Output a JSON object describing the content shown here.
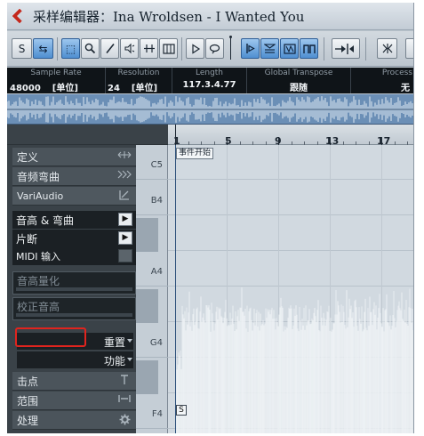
{
  "window": {
    "title": "采样编辑器：Ina Wroldsen - I Wanted You"
  },
  "toolbar": {
    "solo_label": "S",
    "buttons": [
      {
        "name": "solo-button",
        "glyph": "S"
      },
      {
        "name": "listen-button",
        "glyph": "⇆"
      },
      {
        "name": "range-select-tool",
        "glyph": "⬚"
      },
      {
        "name": "zoom-tool",
        "glyph": "🔍"
      },
      {
        "name": "pencil-tool",
        "glyph": "/"
      },
      {
        "name": "play-tool",
        "glyph": "◁"
      },
      {
        "name": "scrub-tool",
        "glyph": "⇋"
      },
      {
        "name": "view-tool",
        "glyph": "▥"
      },
      {
        "name": "play-button",
        "glyph": "▷"
      },
      {
        "name": "loop-button",
        "glyph": "○"
      },
      {
        "name": "snap-zero-button",
        "glyph": "⊳"
      },
      {
        "name": "show-region-button",
        "glyph": "▽"
      },
      {
        "name": "show-events-button",
        "glyph": "▦"
      },
      {
        "name": "marker-button",
        "glyph": "⊓"
      },
      {
        "name": "auto-scroll-button",
        "glyph": "▶"
      },
      {
        "name": "edit-position-button",
        "glyph": "⋈"
      }
    ]
  },
  "infoline": {
    "sample_rate": {
      "label": "Sample Rate",
      "value": "48000",
      "unit": "[单位]"
    },
    "resolution": {
      "label": "Resolution",
      "value": "24",
      "unit": "[单位]"
    },
    "length": {
      "label": "Length",
      "value": "117.3.4.77"
    },
    "global_transpose": {
      "label": "Global Transpose",
      "value": "跟随"
    },
    "process": {
      "label": "Process",
      "value": "无"
    }
  },
  "ruler": {
    "bars": [
      "1",
      "5",
      "9",
      "13",
      "17"
    ]
  },
  "inspector": {
    "definition": "定义",
    "audio_warp": "音频弯曲",
    "variaudio": "VariAudio",
    "pitch_warp": "音高 & 弯曲",
    "segments": "片断",
    "midi_input": "MIDI 输入",
    "quantize_pitch": "音高量化",
    "straighten_pitch": "校正音高",
    "reset": "重置",
    "functions": "功能",
    "hitpoints": "击点",
    "range": "范围",
    "process": "处理"
  },
  "keyboard": {
    "notes": [
      "C5",
      "B4",
      "A4",
      "G4",
      "F4"
    ]
  },
  "events": {
    "start_marker": "事件开始",
    "s_marker": "S"
  },
  "colors": {
    "highlight": "#e0241e",
    "inspector_bg": "#3a4248",
    "event_bg": "#d1d9e0",
    "waveform": "#f0f3f6"
  }
}
